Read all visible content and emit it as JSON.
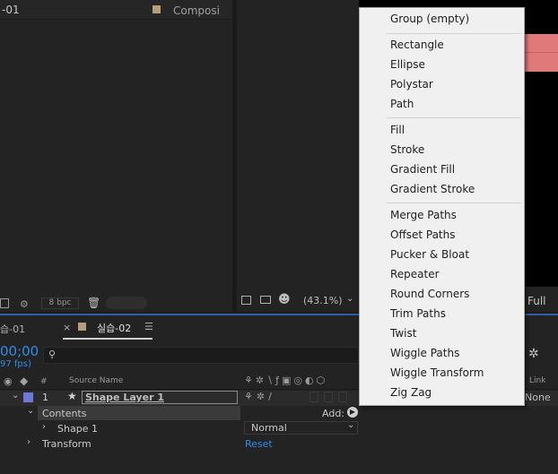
{
  "project_panel": {
    "item_name": "-01",
    "item_type": "Composi",
    "bpc": "8 bpc"
  },
  "viewer": {
    "zoom": "(43.1%)",
    "resolution": "Full"
  },
  "timeline": {
    "tab_prev": "습-01",
    "tab_active": "실습-02",
    "timecode": "00;00",
    "fps": "97 fps)",
    "col_source_name": "Source Name",
    "col_hash": "#",
    "col_link": "Link",
    "layer_number": "1",
    "layer_name": "Shape Layer 1",
    "layer_parent": "None",
    "contents_label": "Contents",
    "add_label": "Add:",
    "shape1_label": "Shape 1",
    "blend_mode": "Normal",
    "transform_label": "Transform",
    "reset_label": "Reset"
  },
  "add_menu": {
    "groups": [
      [
        "Group (empty)"
      ],
      [
        "Rectangle",
        "Ellipse",
        "Polystar",
        "Path"
      ],
      [
        "Fill",
        "Stroke",
        "Gradient Fill",
        "Gradient Stroke"
      ],
      [
        "Merge Paths",
        "Offset Paths",
        "Pucker & Bloat",
        "Repeater",
        "Round Corners",
        "Trim Paths",
        "Twist",
        "Wiggle Paths",
        "Wiggle Transform",
        "Zig Zag"
      ]
    ]
  },
  "colors": {
    "label_tan": "#b59c7a",
    "label_blue": "#6e78d8",
    "accent_blue": "#2d8ceb",
    "shape_pink": "#e07a7a"
  }
}
